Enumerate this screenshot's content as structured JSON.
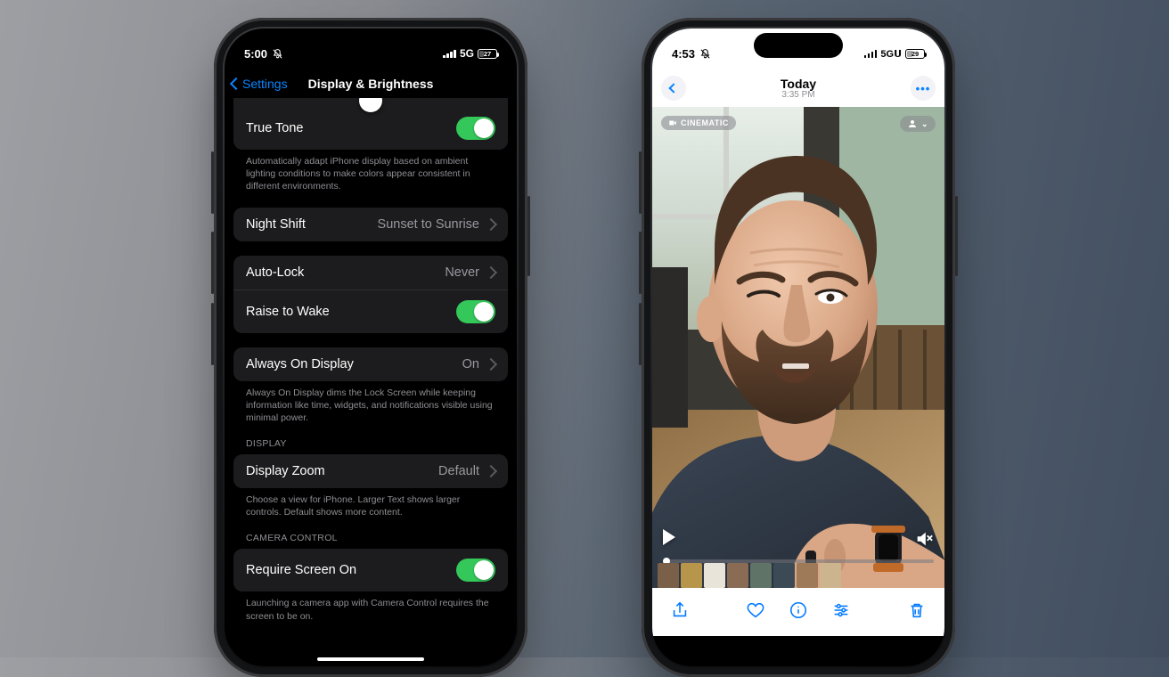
{
  "phones": {
    "left": {
      "status": {
        "time": "5:00",
        "network": "5G",
        "battery": "27"
      },
      "nav": {
        "back": "Settings",
        "title": "Display & Brightness"
      },
      "trueTone": {
        "label": "True Tone"
      },
      "trueToneFooter": "Automatically adapt iPhone display based on ambient lighting conditions to make colors appear consistent in different environments.",
      "nightShift": {
        "label": "Night Shift",
        "value": "Sunset to Sunrise"
      },
      "autoLock": {
        "label": "Auto-Lock",
        "value": "Never"
      },
      "raiseToWake": {
        "label": "Raise to Wake"
      },
      "alwaysOn": {
        "label": "Always On Display",
        "value": "On"
      },
      "alwaysOnFooter": "Always On Display dims the Lock Screen while keeping information like time, widgets, and notifications visible using minimal power.",
      "displayHeader": "DISPLAY",
      "displayZoom": {
        "label": "Display Zoom",
        "value": "Default"
      },
      "displayZoomFooter": "Choose a view for iPhone. Larger Text shows larger controls. Default shows more content.",
      "cameraHeader": "CAMERA CONTROL",
      "requireScreenOn": {
        "label": "Require Screen On"
      },
      "requireScreenOnFooter": "Launching a camera app with Camera Control requires the screen to be on."
    },
    "right": {
      "status": {
        "time": "4:53",
        "network": "5G𝗨",
        "battery": "29"
      },
      "nav": {
        "title": "Today",
        "subtitle": "3:35 PM"
      },
      "cinematicBadge": "CINEMATIC"
    }
  }
}
